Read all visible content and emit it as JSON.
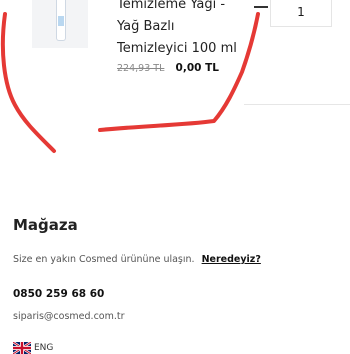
{
  "cart_item": {
    "name": "Temizleme Yağı - Yağ Bazlı Temizleyici 100 ml",
    "old_price": "224,93 TL",
    "new_price": "0,00 TL",
    "minus_symbol": "−",
    "quantity": "1"
  },
  "store": {
    "title": "Mağaza",
    "text": "Size en yakın Cosmed ürününe ulaşın.",
    "link": "Neredeyiz?",
    "phone": "0850 259 68 60",
    "email": "siparis@cosmed.com.tr"
  },
  "language": {
    "label": "ENG",
    "icon": "uk-flag-icon"
  },
  "colors": {
    "scribble": "#e53935"
  }
}
